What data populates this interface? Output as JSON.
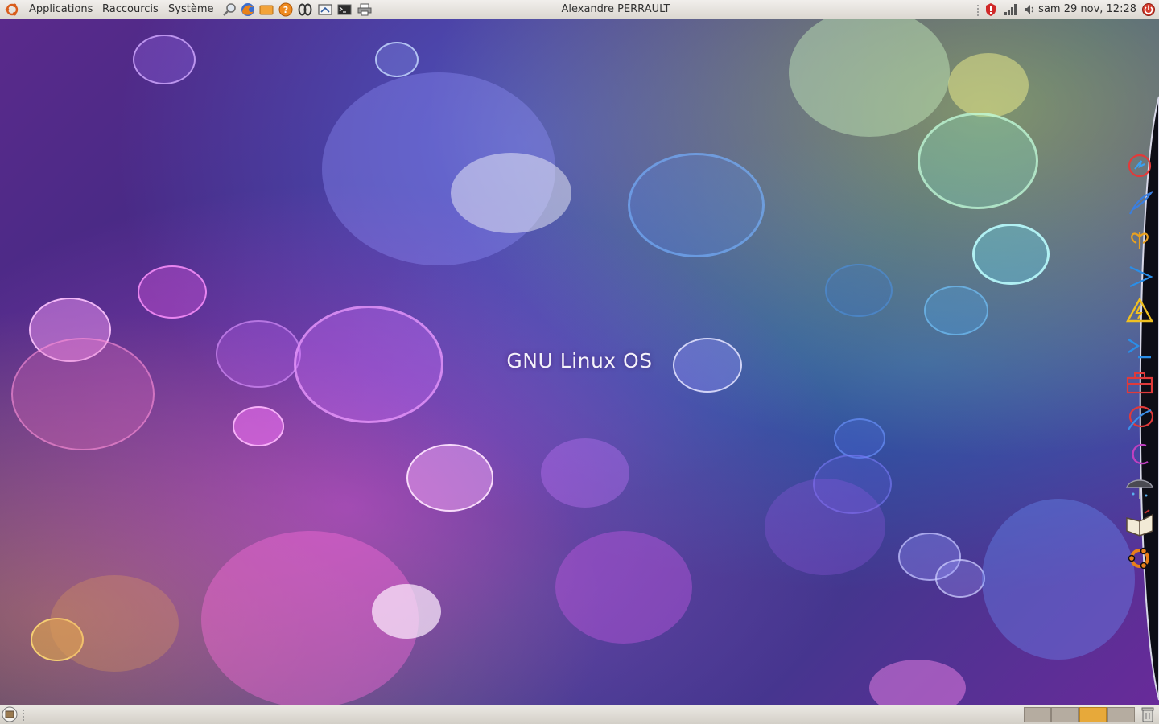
{
  "top_panel": {
    "menus": [
      "Applications",
      "Raccourcis",
      "Système"
    ],
    "launchers": [
      "search-tool-icon",
      "firefox-icon",
      "mail-icon",
      "help-icon",
      "infinity-app-icon",
      "mail-reader-icon",
      "terminal-icon",
      "printer-icon"
    ],
    "title": "Alexandre PERRAULT",
    "tray": [
      "alert-icon",
      "network-signal-icon",
      "volume-icon"
    ],
    "clock": "sam 29 nov, 12:28"
  },
  "desktop": {
    "caption": "GNU Linux OS"
  },
  "dock": {
    "icons": [
      "power-icon",
      "feather-icon",
      "butterfly-icon",
      "play-icon",
      "warning-icon",
      "terminal-prompt-icon",
      "toolbox-icon",
      "network-icon",
      "chat-icon",
      "umbrella-icon",
      "book-icon",
      "ubuntu-icon"
    ]
  },
  "bottom_panel": {
    "workspaces": 4,
    "active_workspace": 3
  },
  "colors": {
    "panel_bg": "#e6e3de",
    "workspace_active": "#e7a93a",
    "workspace_inactive": "#b5aca0"
  }
}
